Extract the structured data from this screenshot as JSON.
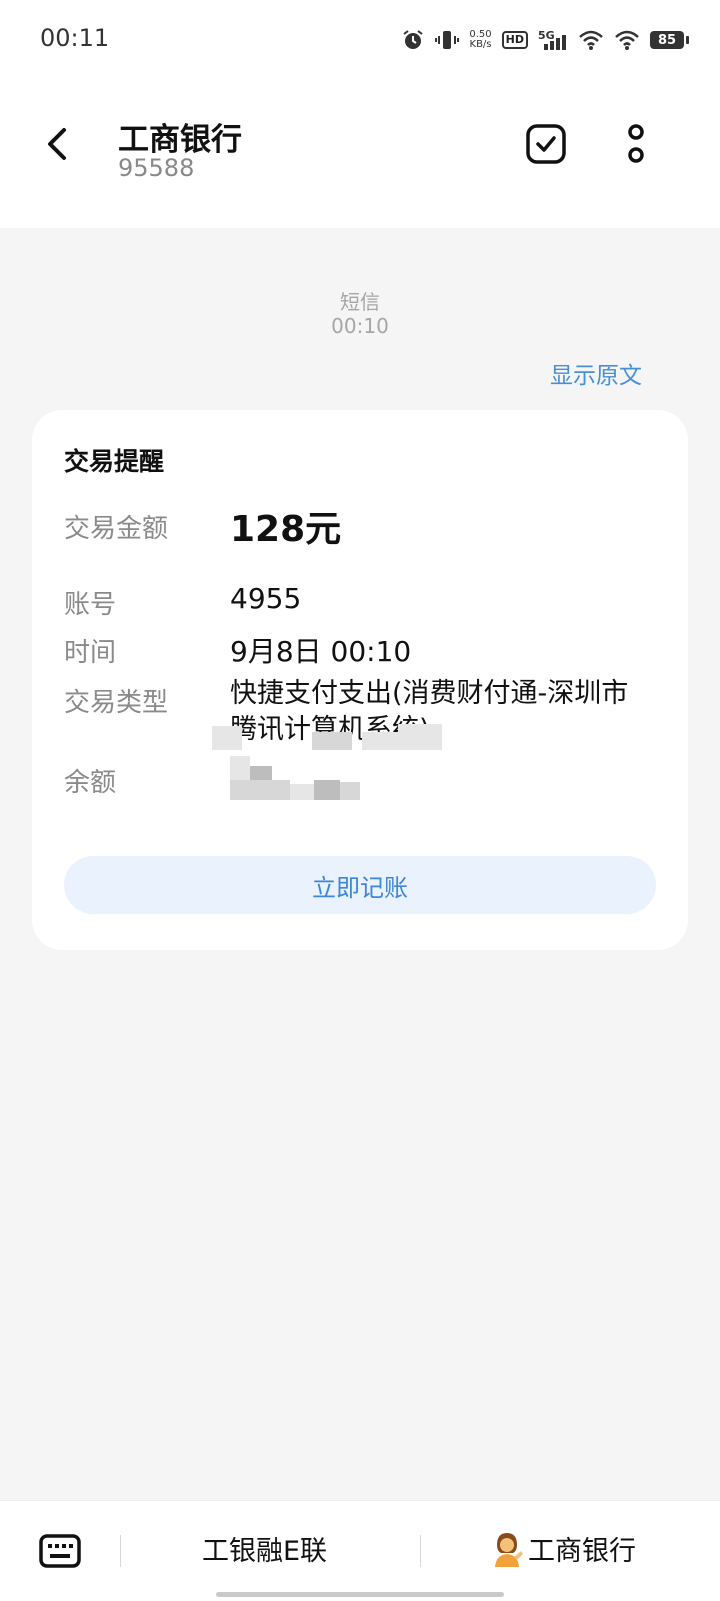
{
  "status_bar": {
    "time": "00:11",
    "net_speed_value": "0.50",
    "net_speed_unit": "KB/s",
    "hd_label": "HD",
    "signal_label": "5G",
    "battery": "85",
    "icons": [
      "alarm-icon",
      "vibrate-icon",
      "hd-icon",
      "signal-5g-icon",
      "wifi-icon",
      "wifi-icon",
      "battery-icon"
    ]
  },
  "header": {
    "title": "工商银行",
    "number": "95588",
    "icons": [
      "back-arrow-icon",
      "select-checkbox-icon",
      "more-vertical-icon"
    ]
  },
  "message": {
    "type": "短信",
    "time": "00:10",
    "show_original": "显示原文"
  },
  "card": {
    "title": "交易提醒",
    "amount_label": "交易金额",
    "amount_value": "128元",
    "account_label": "账号",
    "account_value": "4955",
    "time_label": "时间",
    "time_value": "9月8日 00:10",
    "type_label": "交易类型",
    "type_value": "快捷支付支出(消费财付通-深圳市腾讯计算机系统)",
    "balance_label": "余额",
    "record_button": "立即记账"
  },
  "bottom_bar": {
    "menu1": "工银融E联",
    "menu2": "工商银行",
    "icons": [
      "keyboard-icon",
      "person-icon"
    ]
  },
  "colors": {
    "accent": "#4a8fd6",
    "background": "#f5f5f5",
    "button_bg": "#eaf2fd"
  }
}
